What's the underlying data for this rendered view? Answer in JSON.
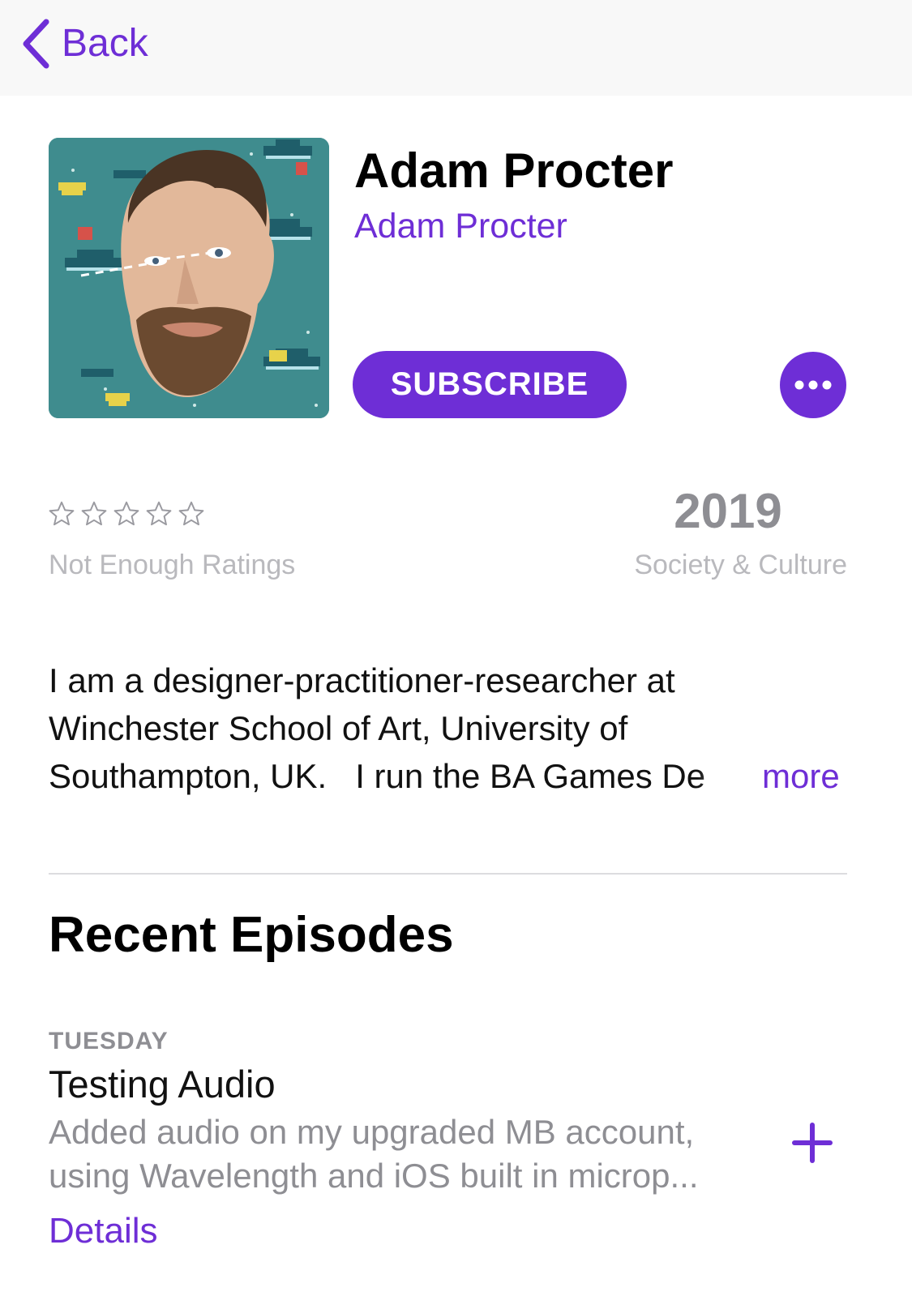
{
  "nav": {
    "back_label": "Back"
  },
  "podcast": {
    "title": "Adam Procter",
    "author": "Adam Procter",
    "subscribe_label": "SUBSCRIBE",
    "rating_stars": 0,
    "rating_max": 5,
    "ratings_label": "Not Enough Ratings",
    "year": "2019",
    "category": "Society & Culture",
    "description_lines": [
      "I am a designer-practitioner-researcher at",
      "Winchester School of Art, University of",
      "Southampton, UK.   I run the BA Games De"
    ],
    "more_label": "more"
  },
  "recent": {
    "section_title": "Recent Episodes",
    "episodes": [
      {
        "day": "TUESDAY",
        "title": "Testing Audio",
        "description_lines": [
          "Added audio on my upgraded MB account,",
          "using Wavelength and iOS built in microp..."
        ],
        "details_label": "Details"
      }
    ]
  },
  "colors": {
    "accent": "#6e2ed6",
    "secondary_text": "#8e8e93",
    "artwork_bg": "#3e8c8f"
  }
}
